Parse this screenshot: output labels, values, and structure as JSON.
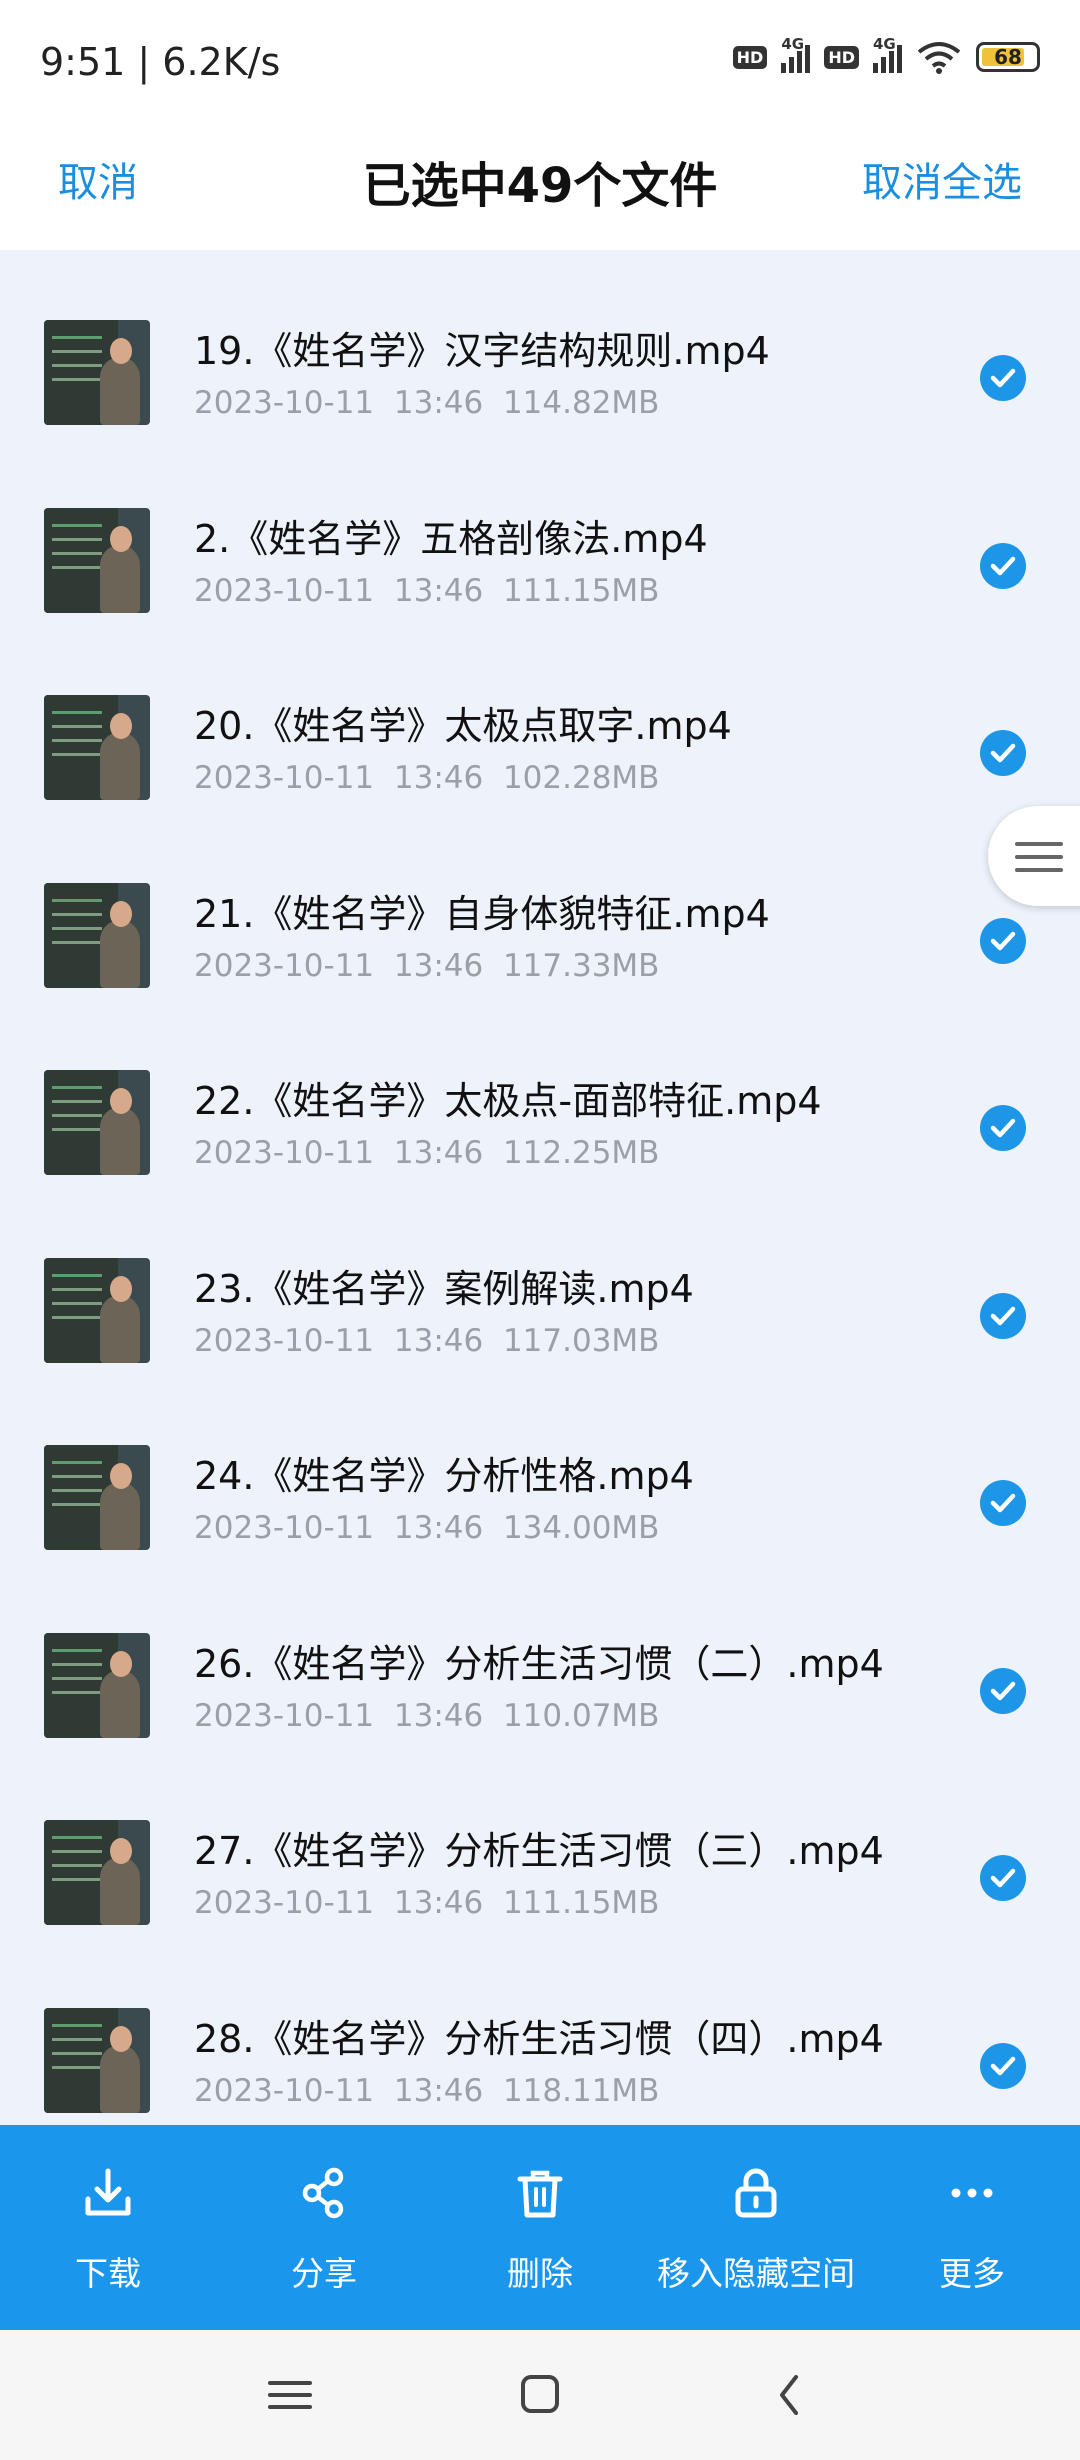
{
  "status_bar": {
    "time": "9:51 | 6.2K/s",
    "hd_label": "HD",
    "net_label": "4G",
    "battery": "68"
  },
  "header": {
    "left_action": "取消",
    "title": "已选中49个文件",
    "right_action": "取消全选"
  },
  "files": [
    {
      "name": "19.《姓名学》汉字结构规则.mp4",
      "date": "2023-10-11",
      "time": "13:46",
      "size": "114.82MB",
      "selected": true
    },
    {
      "name": "2.《姓名学》五格剖像法.mp4",
      "date": "2023-10-11",
      "time": "13:46",
      "size": "111.15MB",
      "selected": true
    },
    {
      "name": "20.《姓名学》太极点取字.mp4",
      "date": "2023-10-11",
      "time": "13:46",
      "size": "102.28MB",
      "selected": true
    },
    {
      "name": "21.《姓名学》自身体貌特征.mp4",
      "date": "2023-10-11",
      "time": "13:46",
      "size": "117.33MB",
      "selected": true
    },
    {
      "name": "22.《姓名学》太极点-面部特征.mp4",
      "date": "2023-10-11",
      "time": "13:46",
      "size": "112.25MB",
      "selected": true
    },
    {
      "name": "23.《姓名学》案例解读.mp4",
      "date": "2023-10-11",
      "time": "13:46",
      "size": "117.03MB",
      "selected": true
    },
    {
      "name": "24.《姓名学》分析性格.mp4",
      "date": "2023-10-11",
      "time": "13:46",
      "size": "134.00MB",
      "selected": true
    },
    {
      "name": "26.《姓名学》分析生活习惯（二）.mp4",
      "date": "2023-10-11",
      "time": "13:46",
      "size": "110.07MB",
      "selected": true
    },
    {
      "name": "27.《姓名学》分析生活习惯（三）.mp4",
      "date": "2023-10-11",
      "time": "13:46",
      "size": "111.15MB",
      "selected": true
    },
    {
      "name": "28.《姓名学》分析生活习惯（四）.mp4",
      "date": "2023-10-11",
      "time": "13:46",
      "size": "118.11MB",
      "selected": true
    }
  ],
  "actions": [
    {
      "label": "下载",
      "icon": "download-icon"
    },
    {
      "label": "分享",
      "icon": "share-icon"
    },
    {
      "label": "删除",
      "icon": "trash-icon"
    },
    {
      "label": "移入隐藏空间",
      "icon": "lock-icon"
    },
    {
      "label": "更多",
      "icon": "more-icon"
    }
  ],
  "colors": {
    "accent": "#1a97ec",
    "background": "#edf2fb",
    "meta_text": "#9aa0a8"
  }
}
